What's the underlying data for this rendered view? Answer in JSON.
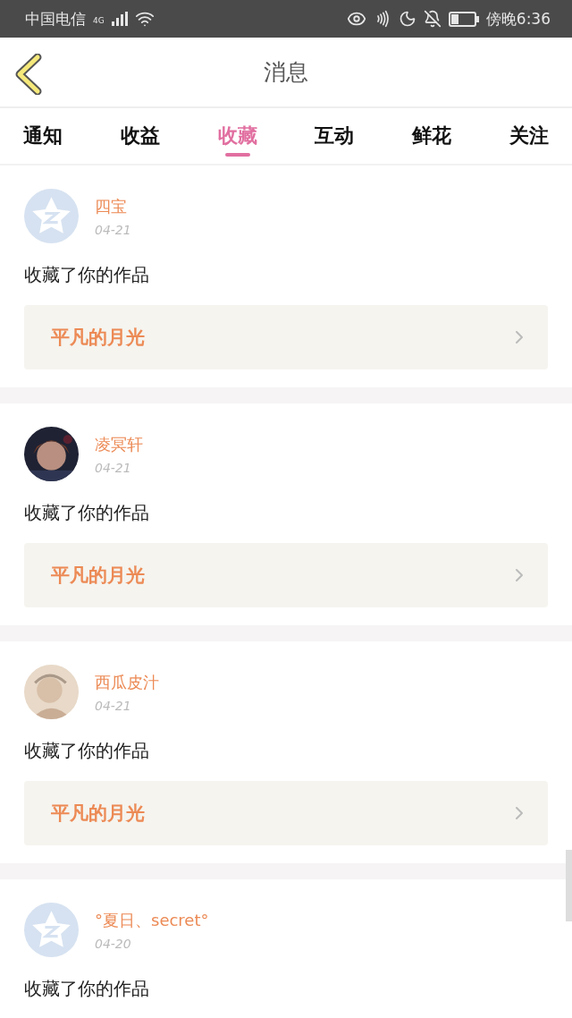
{
  "status_bar": {
    "carrier": "中国电信",
    "network": "4G",
    "time": "傍晚6:36"
  },
  "header": {
    "title": "消息"
  },
  "tabs": [
    {
      "label": "通知",
      "selected": false
    },
    {
      "label": "收益",
      "selected": false
    },
    {
      "label": "收藏",
      "selected": true
    },
    {
      "label": "互动",
      "selected": false
    },
    {
      "label": "鲜花",
      "selected": false
    },
    {
      "label": "关注",
      "selected": false
    }
  ],
  "messages": [
    {
      "user": "四宝",
      "kind": "default",
      "date": "04-21",
      "text": "收藏了你的作品",
      "work": "平凡的月光"
    },
    {
      "user": "凌冥轩",
      "kind": "picture",
      "date": "04-21",
      "text": "收藏了你的作品",
      "work": "平凡的月光"
    },
    {
      "user": "西瓜皮汁",
      "kind": "sketch",
      "date": "04-21",
      "text": "收藏了你的作品",
      "work": "平凡的月光"
    },
    {
      "user": "°夏日、secret°",
      "kind": "default",
      "date": "04-20",
      "text": "收藏了你的作品"
    }
  ]
}
